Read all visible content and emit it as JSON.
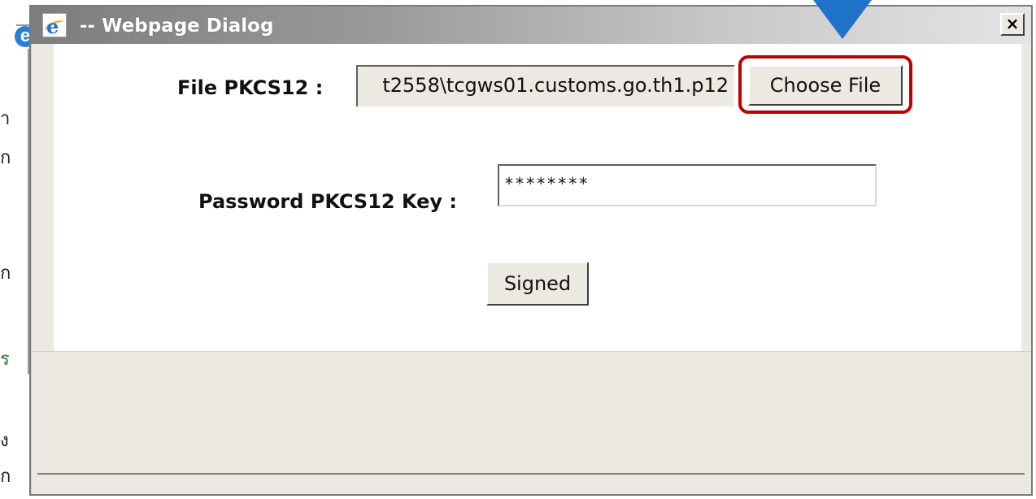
{
  "background": {
    "fragments": [
      "า",
      "ก",
      "ก",
      "ร",
      "ง",
      "ก"
    ]
  },
  "dialog": {
    "title": "-- Webpage Dialog",
    "close_label": "×",
    "file_label": "File PKCS12 :",
    "file_value": "t2558\\tcgws01.customs.go.th1.p12",
    "choose_label": "Choose File",
    "password_label": "Password PKCS12 Key :",
    "password_value": "********",
    "signed_label": "Signed"
  },
  "colors": {
    "highlight": "#c00000",
    "arrow": "#1e73c8",
    "title_text": "#ffffff"
  },
  "icons": {
    "title": "internet-explorer-icon",
    "close": "close-icon",
    "marker": "arrow-down-icon"
  }
}
